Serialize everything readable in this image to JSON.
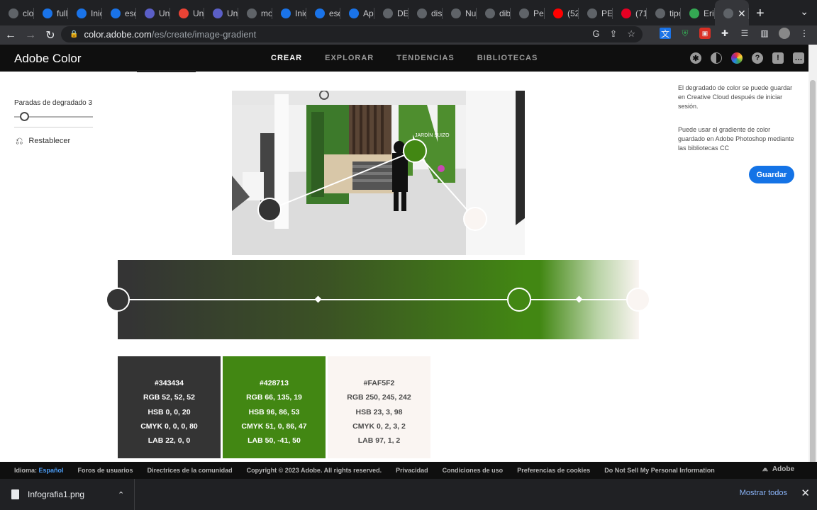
{
  "browser": {
    "tabs": [
      {
        "label": "clo",
        "icon": "globe-icon",
        "color": "#5f6368"
      },
      {
        "label": "full",
        "icon": "app-icon",
        "color": "#1a73e8"
      },
      {
        "label": "Inic",
        "icon": "edge-icon",
        "color": "#1a73e8"
      },
      {
        "label": "esq",
        "icon": "edge-icon",
        "color": "#1a73e8"
      },
      {
        "label": "Uni",
        "icon": "teams-icon",
        "color": "#5b5fc7"
      },
      {
        "label": "Uni",
        "icon": "gmail-icon",
        "color": "#ea4335"
      },
      {
        "label": "Uni",
        "icon": "teams-icon",
        "color": "#5b5fc7"
      },
      {
        "label": "mol",
        "icon": "google-icon",
        "color": "#5f6368"
      },
      {
        "label": "Inic",
        "icon": "edge-icon",
        "color": "#1a73e8"
      },
      {
        "label": "esq",
        "icon": "edge-icon",
        "color": "#1a73e8"
      },
      {
        "label": "Apl",
        "icon": "edge-icon",
        "color": "#1a73e8"
      },
      {
        "label": "DE",
        "icon": "google-icon",
        "color": "#5f6368"
      },
      {
        "label": "dis",
        "icon": "google-icon",
        "color": "#5f6368"
      },
      {
        "label": "Nu",
        "icon": "chrome-icon",
        "color": "#5f6368"
      },
      {
        "label": "dib",
        "icon": "google-icon",
        "color": "#5f6368"
      },
      {
        "label": "Per",
        "icon": "triangle-icon",
        "color": "#5f6368"
      },
      {
        "label": "(52",
        "icon": "youtube-icon",
        "color": "#ff0000"
      },
      {
        "label": "PEF",
        "icon": "google-icon",
        "color": "#5f6368"
      },
      {
        "label": "(71",
        "icon": "pinterest-icon",
        "color": "#e60023"
      },
      {
        "label": "tipo",
        "icon": "google-icon",
        "color": "#5f6368"
      },
      {
        "label": "Eric",
        "icon": "drive-icon",
        "color": "#34a853"
      }
    ],
    "active_tab_close": "✕",
    "new_tab": "+",
    "url_domain": "color.adobe.com",
    "url_path": "/es/create/image-gradient"
  },
  "app": {
    "brand": "Adobe Color",
    "nav": [
      {
        "label": "CREAR",
        "active": true
      },
      {
        "label": "EXPLORAR",
        "active": false
      },
      {
        "label": "TENDENCIAS",
        "active": false
      },
      {
        "label": "BIBLIOTECAS",
        "active": false
      }
    ]
  },
  "left_panel": {
    "stops_label": "Paradas de degradado",
    "stops_value": "3",
    "reset_label": "Restablecer"
  },
  "right_panel": {
    "note1": "El degradado de color se puede guardar en Creative Cloud después de iniciar sesión.",
    "note2": "Puede usar el gradiente de color guardado en Adobe Photoshop mediante las bibliotecas CC",
    "save_label": "Guardar"
  },
  "swatches": [
    {
      "hex": "#343434",
      "rgb": "RGB 52, 52, 52",
      "hsb": "HSB 0, 0, 20",
      "cmyk": "CMYK 0, 0, 0, 80",
      "lab": "LAB 22, 0, 0",
      "bg": "#343434",
      "fg": "#ffffff"
    },
    {
      "hex": "#428713",
      "rgb": "RGB 66, 135, 19",
      "hsb": "HSB 96, 86, 53",
      "cmyk": "CMYK 51, 0, 86, 47",
      "lab": "LAB 50, -41, 50",
      "bg": "#428713",
      "fg": "#ffffff"
    },
    {
      "hex": "#FAF5F2",
      "rgb": "RGB 250, 245, 242",
      "hsb": "HSB 23, 3, 98",
      "cmyk": "CMYK 0, 2, 3, 2",
      "lab": "LAB 97, 1, 2",
      "bg": "#faf5f2",
      "fg": "#4b4b4b"
    }
  ],
  "footer": {
    "lang_label": "Idioma:",
    "lang_value": "Español",
    "links": [
      "Foros de usuarios",
      "Directrices de la comunidad",
      "Copyright © 2023 Adobe. All rights reserved.",
      "Privacidad",
      "Condiciones de uso",
      "Preferencias de cookies",
      "Do Not Sell My Personal Information"
    ],
    "adobe": "Adobe"
  },
  "downloads": {
    "file": "Infografia1.png",
    "show_all": "Mostrar todos"
  },
  "photo_text": {
    "sign": "JARDÍN SUIZO"
  }
}
